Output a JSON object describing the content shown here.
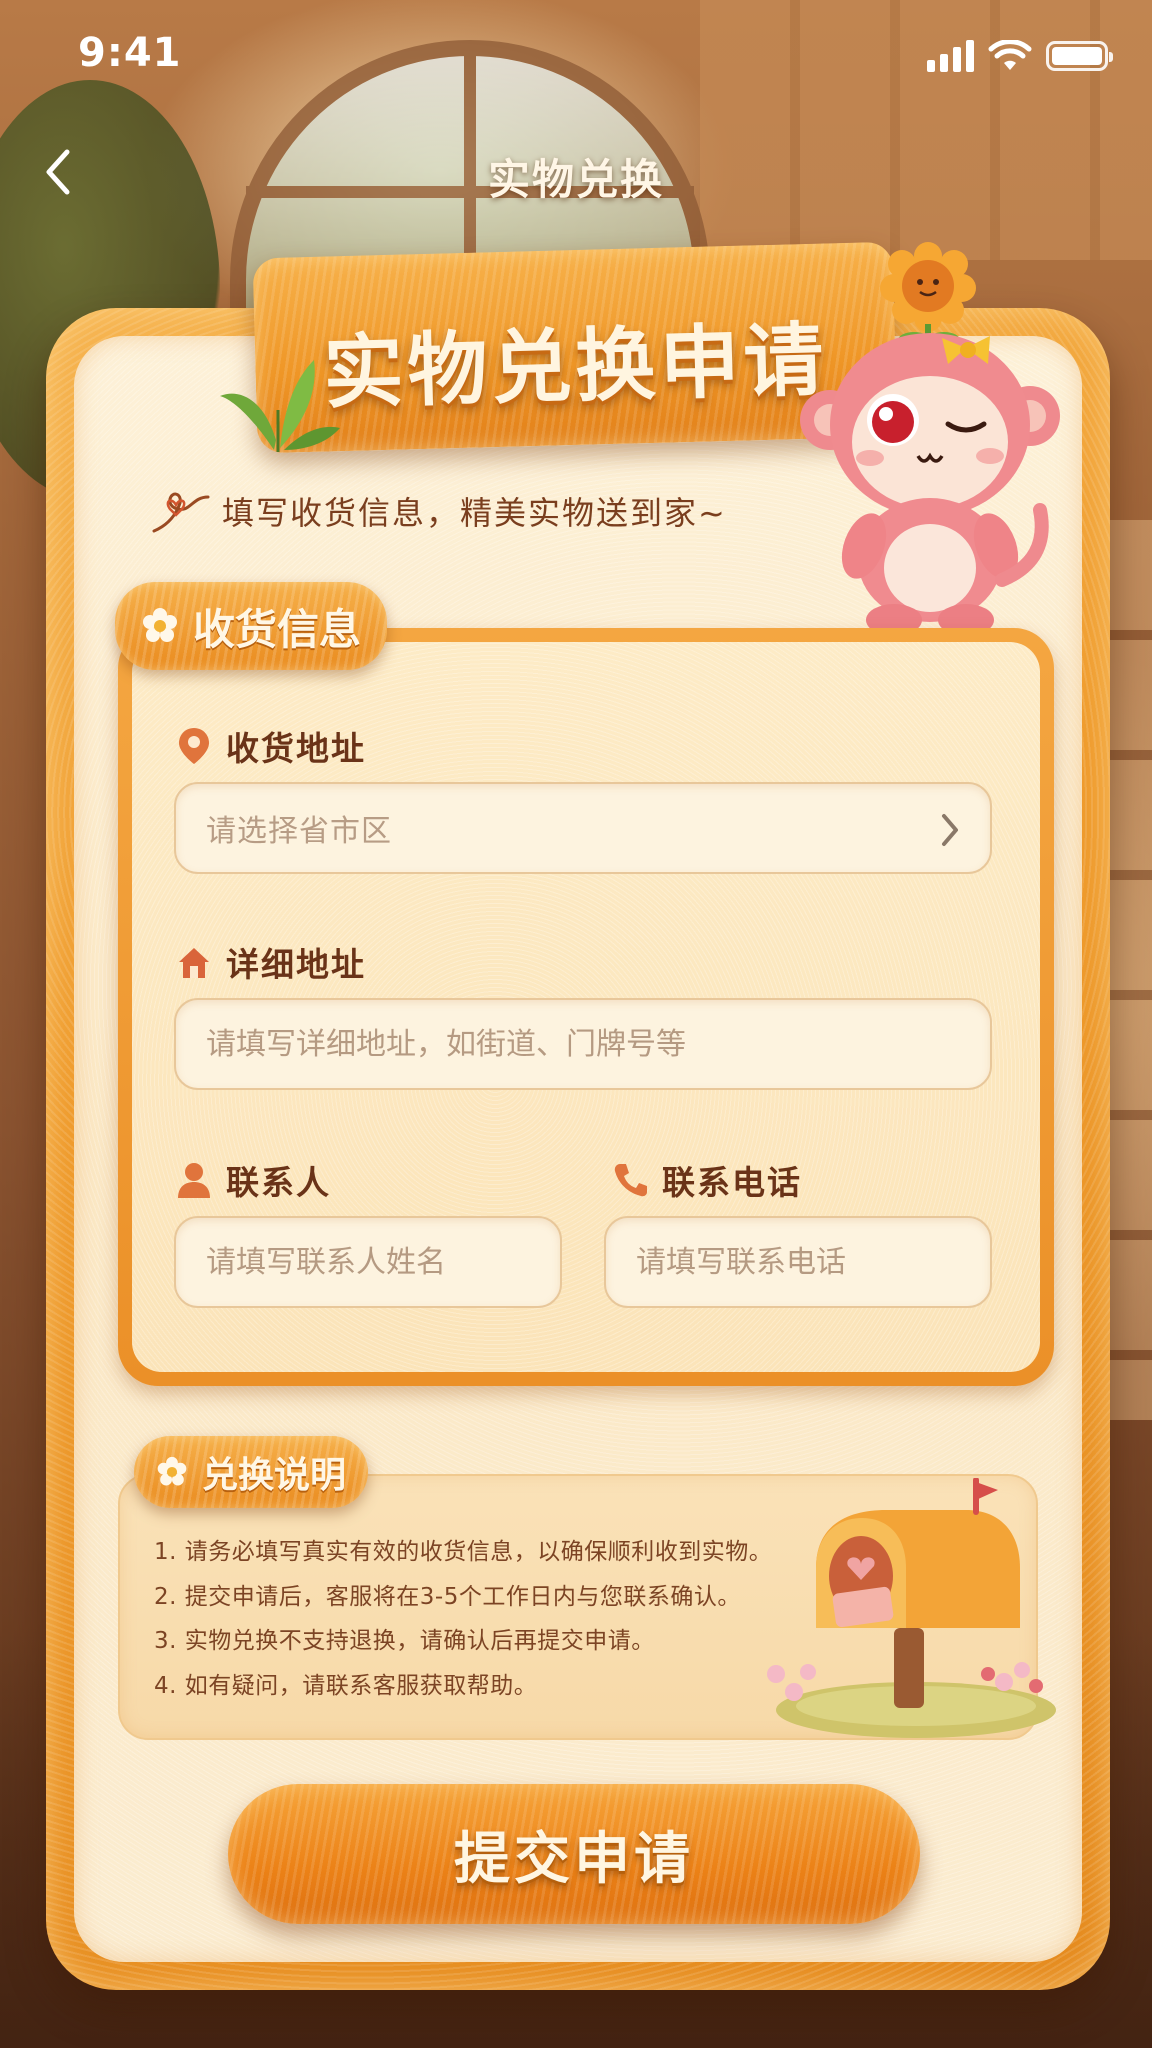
{
  "status_bar": {
    "time": "9:41"
  },
  "nav": {
    "back_icon": "chevron-left-icon",
    "title": "实物兑换"
  },
  "banner": {
    "title": "实物兑换申请",
    "subtitle": "填写收货信息，精美实物送到家~"
  },
  "shipping": {
    "section_title": "收货信息",
    "region": {
      "label": "收货地址",
      "placeholder": "请选择省市区",
      "icon": "location-pin-icon"
    },
    "detail": {
      "label": "详细地址",
      "placeholder": "请填写详细地址，如街道、门牌号等",
      "icon": "house-icon"
    },
    "contact": {
      "label": "联系人",
      "placeholder": "请填写联系人姓名",
      "icon": "person-icon"
    },
    "phone": {
      "label": "联系电话",
      "placeholder": "请填写联系电话",
      "icon": "phone-icon"
    }
  },
  "notes": {
    "section_title": "兑换说明",
    "items": [
      "1. 请务必填写真实有效的收货信息，以确保顺利收到实物。",
      "2. 提交申请后，客服将在3-5个工作日内与您联系确认。",
      "3. 实物兑换不支持退换，请确认后再提交申请。",
      "4. 如有疑问，请联系客服获取帮助。"
    ]
  },
  "submit": {
    "label": "提交申请"
  },
  "colors": {
    "accent_orange": "#ec8217",
    "card_cream": "#fdf1d8",
    "label_brown": "#6a3318",
    "placeholder": "#b59a82"
  }
}
